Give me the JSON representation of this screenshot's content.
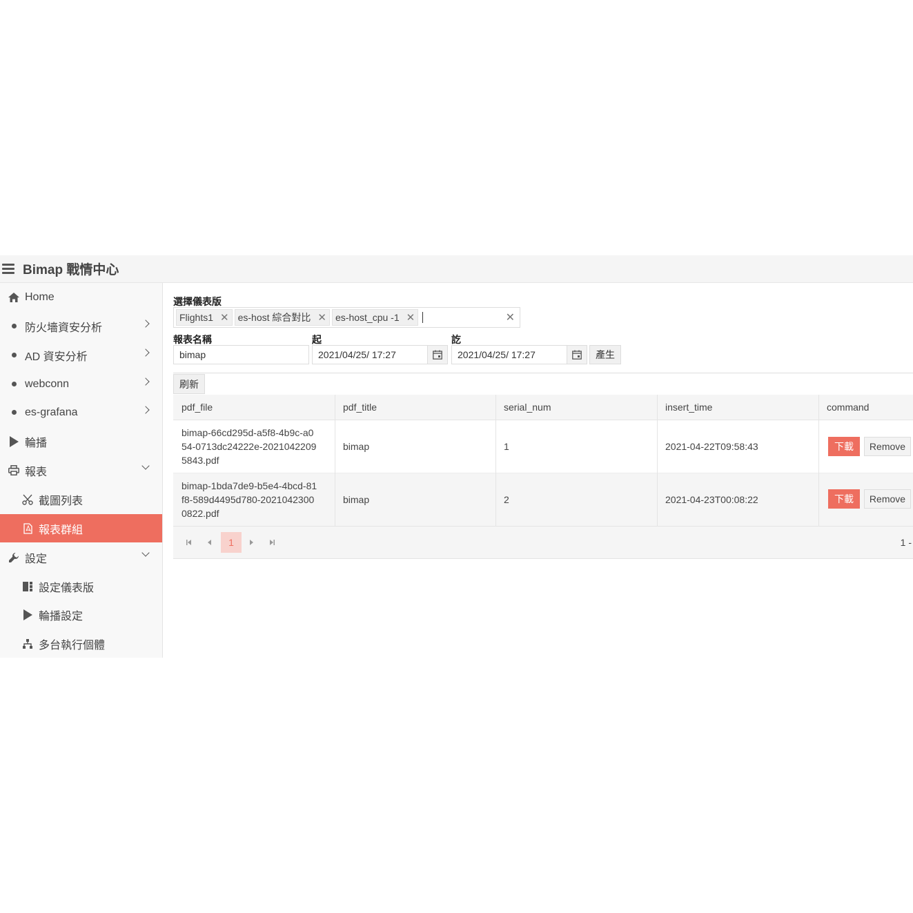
{
  "app": {
    "title": "Bimap 戰情中心"
  },
  "sidebar": {
    "items": [
      {
        "label": "Home"
      },
      {
        "label": "防火墻資安分析"
      },
      {
        "label": "AD 資安分析"
      },
      {
        "label": "webconn"
      },
      {
        "label": "es-grafana"
      },
      {
        "label": "輪播"
      },
      {
        "label": "報表"
      },
      {
        "label": "截圖列表"
      },
      {
        "label": "報表群組"
      },
      {
        "label": "設定"
      },
      {
        "label": "設定儀表版"
      },
      {
        "label": "輪播設定"
      },
      {
        "label": "多台執行個體"
      }
    ]
  },
  "form": {
    "dashboard_label": "選擇儀表版",
    "chips": [
      "Flights1",
      "es-host 綜合對比",
      "es-host_cpu -1"
    ],
    "report_name_label": "報表名稱",
    "report_name_value": "bimap",
    "start_label": "起",
    "start_value": "2021/04/25/ 17:27",
    "end_label": "訖",
    "end_value": "2021/04/25/ 17:27",
    "generate_label": "產生",
    "refresh_label": "刷新"
  },
  "table": {
    "columns": [
      "pdf_file",
      "pdf_title",
      "serial_num",
      "insert_time",
      "command"
    ],
    "rows": [
      {
        "pdf_file": "bimap-66cd295d-a5f8-4b9c-a054-0713dc24222e-20210422095843.pdf",
        "pdf_title": "bimap",
        "serial_num": "1",
        "insert_time": "2021-04-22T09:58:43"
      },
      {
        "pdf_file": "bimap-1bda7de9-b5e4-4bcd-81f8-589d4495d780-20210423000822.pdf",
        "pdf_title": "bimap",
        "serial_num": "2",
        "insert_time": "2021-04-23T00:08:22"
      }
    ],
    "download_label": "下載",
    "remove_label": "Remove"
  },
  "pager": {
    "current": "1",
    "summary": "1 -"
  },
  "colors": {
    "accent": "#ee6e5f"
  }
}
